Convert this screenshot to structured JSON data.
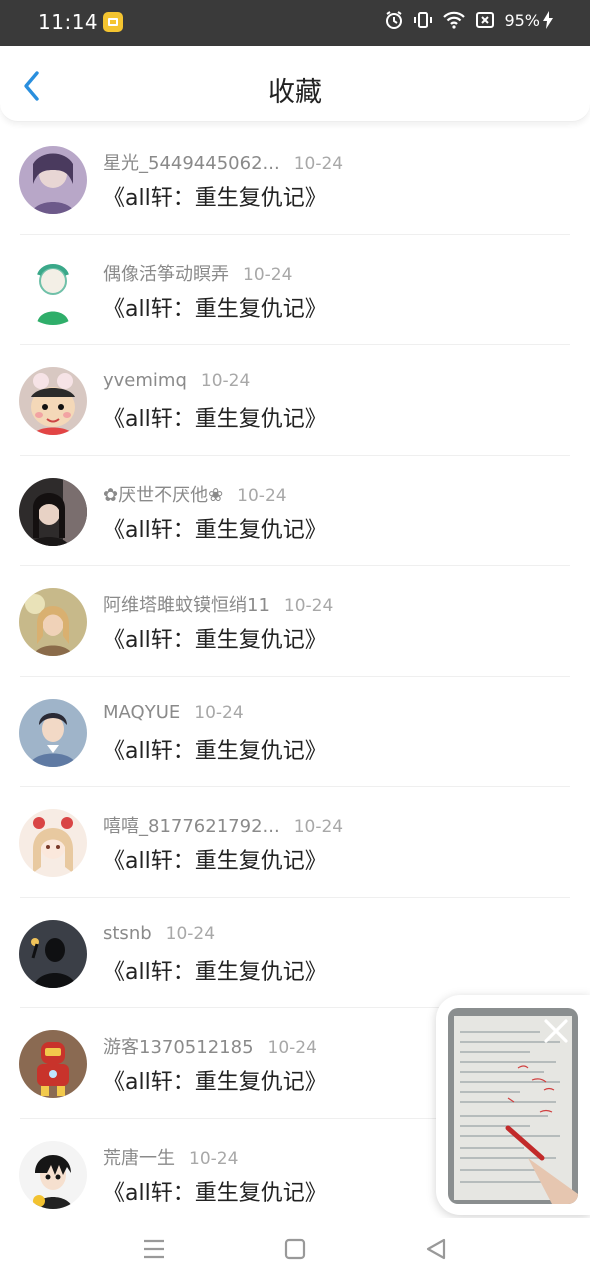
{
  "status_bar": {
    "time": "11:14",
    "battery_percent": "95%",
    "icons": [
      "gallery-app-icon",
      "alarm-icon",
      "vibrate-icon",
      "wifi-icon",
      "sim-blocked-icon",
      "battery-icon",
      "charging-bolt-icon"
    ]
  },
  "header": {
    "title": "收藏",
    "back_icon": "chevron-left-icon",
    "accent": "#2a8fde"
  },
  "favorites": [
    {
      "user": "星光_5449445062...",
      "date": "10-24",
      "book": "《all轩：重生复仇记》"
    },
    {
      "user": "偶像活筝动瞑弄",
      "date": "10-24",
      "book": "《all轩：重生复仇记》"
    },
    {
      "user": "yvemimq",
      "date": "10-24",
      "book": "《all轩：重生复仇记》"
    },
    {
      "user": "✿厌世不厌他❀",
      "date": "10-24",
      "book": "《all轩：重生复仇记》"
    },
    {
      "user": "阿维塔雎蚊镆恒绡11",
      "date": "10-24",
      "book": "《all轩：重生复仇记》"
    },
    {
      "user": "MAQYUE",
      "date": "10-24",
      "book": "《all轩：重生复仇记》"
    },
    {
      "user": "嘻嘻_8177621792...",
      "date": "10-24",
      "book": "《all轩：重生复仇记》"
    },
    {
      "user": "stsnb",
      "date": "10-24",
      "book": "《all轩：重生复仇记》"
    },
    {
      "user": "游客1370512185",
      "date": "10-24",
      "book": "《all轩：重生复仇记》"
    },
    {
      "user": "荒唐一生",
      "date": "10-24",
      "book": "《all轩：重生复仇记》"
    }
  ],
  "floating_video": {
    "close_icon": "close-icon"
  },
  "nav_bar": {
    "icons": [
      "menu-icon",
      "home-square-icon",
      "back-triangle-icon"
    ]
  }
}
